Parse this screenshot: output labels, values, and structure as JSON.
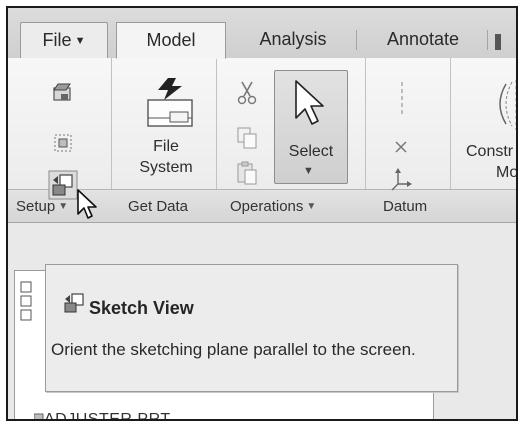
{
  "tabs": [
    {
      "label": "File",
      "dropdown": true
    },
    {
      "label": "Model",
      "active": true
    },
    {
      "label": "Analysis"
    },
    {
      "label": "Annotate"
    }
  ],
  "ribbon": {
    "file_system_line1": "File",
    "file_system_line2": "System",
    "select_label": "Select",
    "construct_partial_line1": "Constr",
    "construct_partial_line2": "Mo"
  },
  "groups": [
    {
      "label": "Setup",
      "dropdown": true
    },
    {
      "label": "Get Data",
      "dropdown": false
    },
    {
      "label": "Operations",
      "dropdown": true
    },
    {
      "label": "Datum",
      "dropdown": false
    }
  ],
  "tooltip": {
    "title": "Sketch View",
    "body": "Orient the sketching plane parallel to the screen."
  },
  "model_tree": {
    "partial_item": "ADJUSTER.PRT"
  },
  "icons": {
    "setup_1": "plane-icon",
    "setup_2": "sketch-setup-icon",
    "setup_3": "sketch-view-icon",
    "file_system": "file-system-icon",
    "cut": "scissors-icon",
    "copy": "copy-icon",
    "paste": "paste-icon",
    "select": "arrow-pointer-icon",
    "datum_axis": "axis-icon",
    "datum_point": "point-icon",
    "datum_csys": "coordinate-system-icon",
    "construct": "construct-icon"
  },
  "colors": {
    "ribbon_bg": "#f2f2f2",
    "tooltip_bg": "#ececec",
    "frame_border": "#1a1a1a"
  }
}
